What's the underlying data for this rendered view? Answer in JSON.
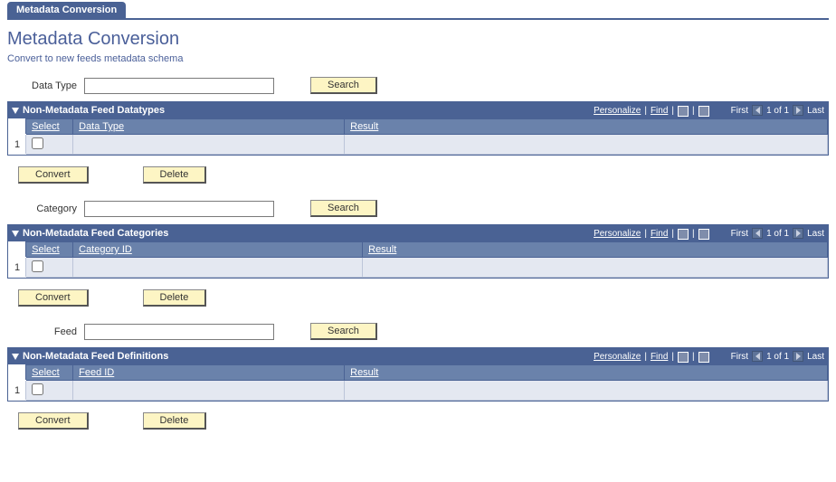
{
  "tab": {
    "label": "Metadata Conversion"
  },
  "page": {
    "title": "Metadata Conversion",
    "description": "Convert to new feeds metadata schema"
  },
  "search": {
    "datatype_label": "Data Type",
    "datatype_value": "",
    "category_label": "Category",
    "category_value": "",
    "feed_label": "Feed",
    "feed_value": "",
    "search_btn": "Search"
  },
  "buttons": {
    "convert": "Convert",
    "delete": "Delete"
  },
  "grid_common": {
    "personalize": "Personalize",
    "find": "Find",
    "first": "First",
    "last": "Last",
    "pager": "1 of 1",
    "col_select": "Select",
    "col_result": "Result",
    "row1": "1"
  },
  "grids": {
    "datatypes": {
      "title": "Non-Metadata Feed Datatypes",
      "col2": "Data Type"
    },
    "categories": {
      "title": "Non-Metadata Feed Categories",
      "col2": "Category ID"
    },
    "definitions": {
      "title": "Non-Metadata Feed Definitions",
      "col2": "Feed ID"
    }
  }
}
